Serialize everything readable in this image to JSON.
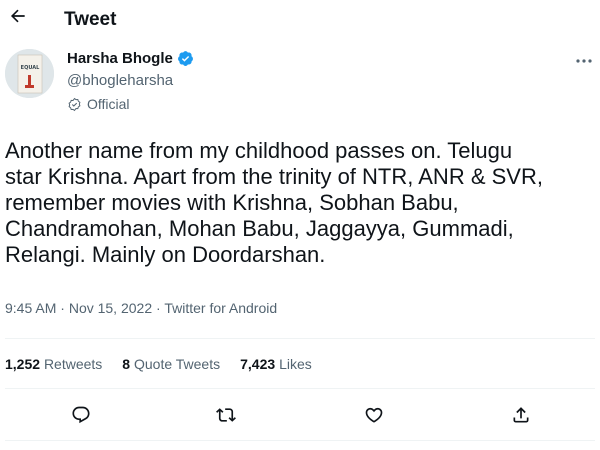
{
  "header": {
    "title": "Tweet",
    "back_icon": "arrow-left-icon"
  },
  "author": {
    "display_name": "Harsha Bhogle",
    "handle": "@bhogleharsha",
    "label": "Official",
    "verified_color": "#1d9bf0",
    "avatar_text": "EQUAL"
  },
  "tweet": {
    "text": "Another name from my childhood passes on. Telugu\nstar Krishna. Apart from the trinity of NTR, ANR & SVR,\nremember movies with Krishna, Sobhan Babu,\nChandramohan, Mohan Babu, Jaggayya, Gummadi,\nRelangi. Mainly on Doordarshan."
  },
  "meta": {
    "time": "9:45 AM",
    "separator": "·",
    "date": "Nov 15, 2022",
    "source": "Twitter for Android"
  },
  "stats": {
    "retweets_count": "1,252",
    "retweets_label": "Retweets",
    "quotes_count": "8",
    "quotes_label": "Quote Tweets",
    "likes_count": "7,423",
    "likes_label": "Likes"
  },
  "actions": [
    "reply-icon",
    "retweet-icon",
    "like-icon",
    "share-icon"
  ],
  "colors": {
    "text": "#0f1419",
    "secondary": "#536471",
    "divider": "#eff3f4",
    "accent": "#1d9bf0"
  }
}
